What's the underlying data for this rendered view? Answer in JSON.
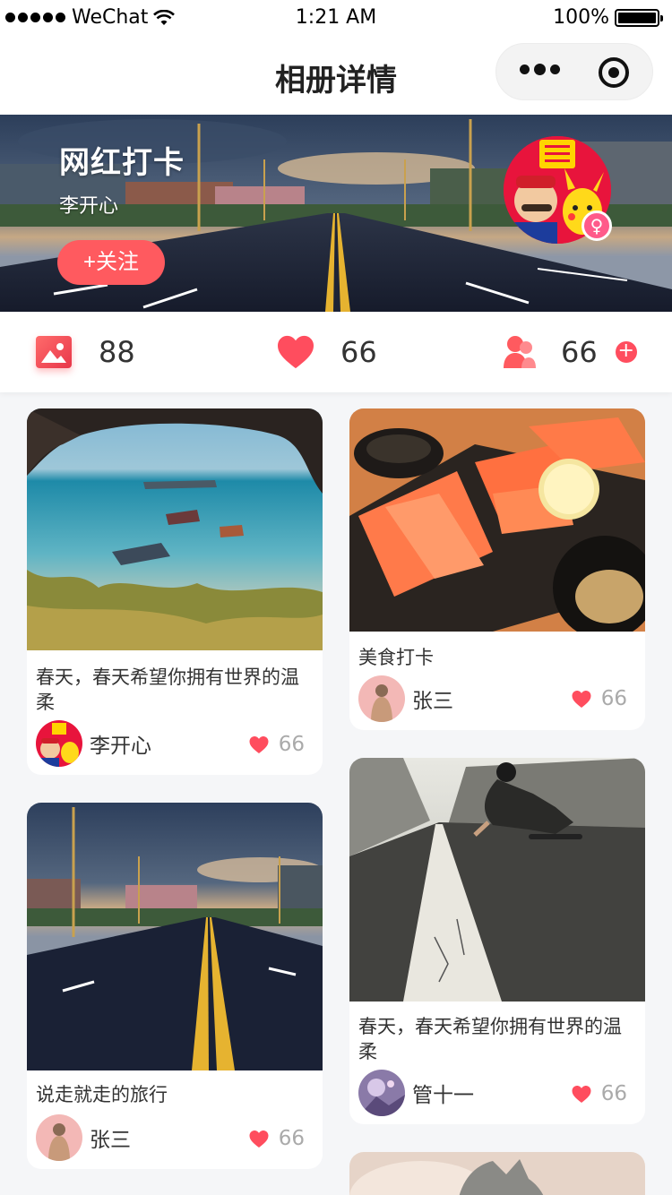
{
  "status_bar": {
    "carrier": "WeChat",
    "time": "1:21 AM",
    "battery": "100%"
  },
  "nav": {
    "title": "相册详情"
  },
  "album": {
    "title": "网红打卡",
    "owner": "李开心",
    "follow_label": "+关注"
  },
  "stats": {
    "photos": "88",
    "likes": "66",
    "fans": "66",
    "add_label": "+"
  },
  "colors": {
    "accent": "#ff5a5f",
    "heart": "#ff4d5e"
  },
  "posts": [
    {
      "caption": "春天，春天希望你拥有世界的温柔",
      "author": "李开心",
      "likes": "66"
    },
    {
      "caption": "美食打卡",
      "author": "张三",
      "likes": "66"
    },
    {
      "caption": "说走就走的旅行",
      "author": "张三",
      "likes": "66"
    },
    {
      "caption": "春天，春天希望你拥有世界的温柔",
      "author": "管十一",
      "likes": "66"
    }
  ]
}
